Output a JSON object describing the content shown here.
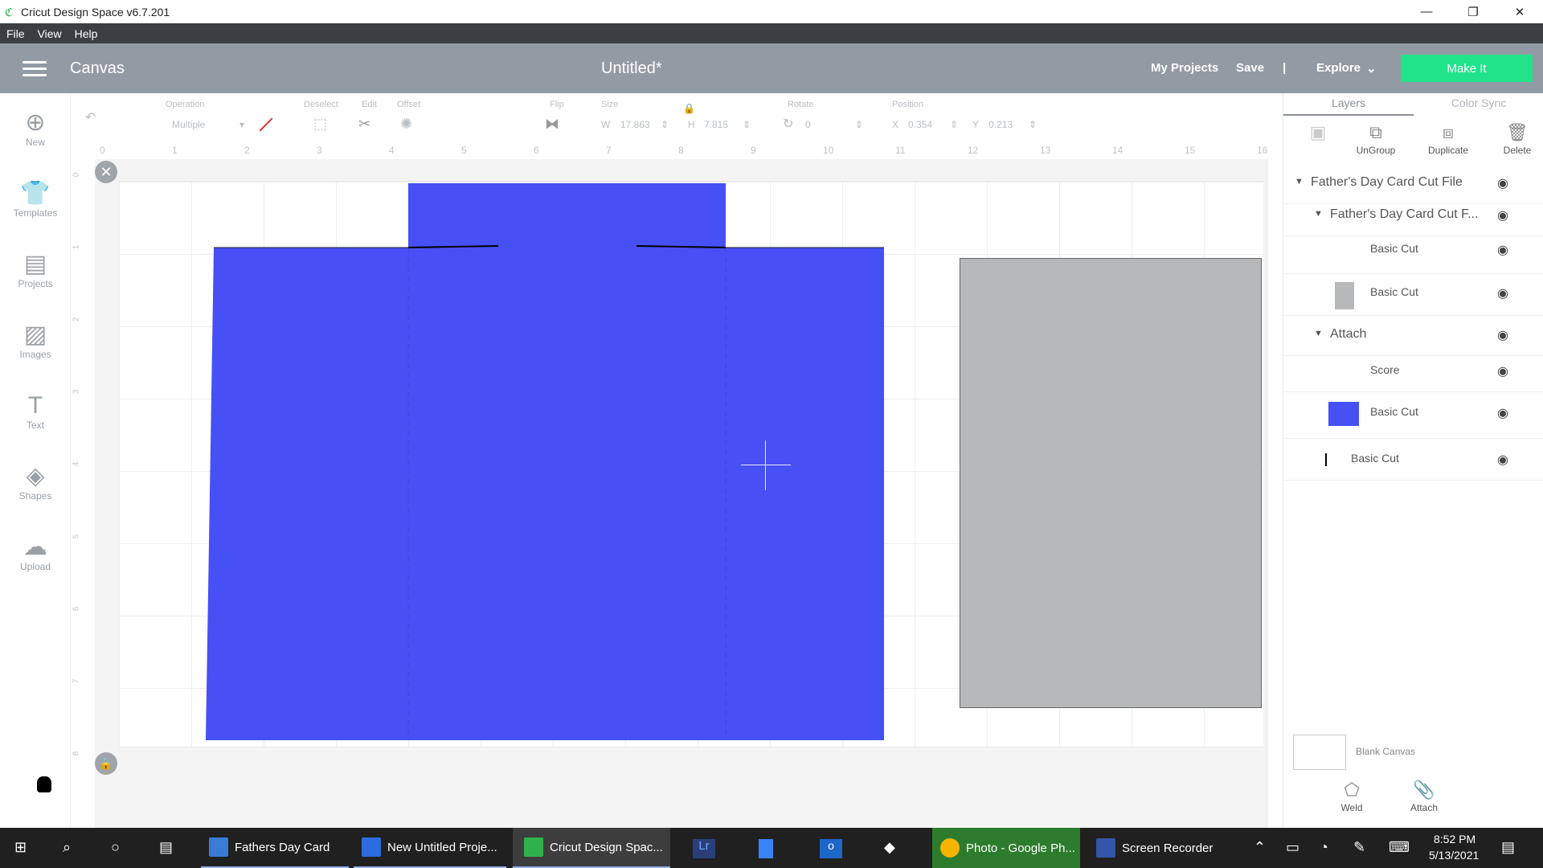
{
  "titlebar": {
    "title": "Cricut Design Space  v6.7.201",
    "minimize": "—",
    "maximize": "❐",
    "close": "✕"
  },
  "menubar": {
    "items": [
      "File",
      "View",
      "Help"
    ]
  },
  "header": {
    "canvas_label": "Canvas",
    "doc_title": "Untitled*",
    "my_projects": "My Projects",
    "save": "Save",
    "separator": "|",
    "explore": "Explore",
    "make_it": "Make It"
  },
  "leftbar": {
    "items": [
      {
        "label": "New",
        "icon": "plus-circle-icon"
      },
      {
        "label": "Templates",
        "icon": "tshirt-icon"
      },
      {
        "label": "Projects",
        "icon": "projects-icon"
      },
      {
        "label": "Images",
        "icon": "image-icon"
      },
      {
        "label": "Text",
        "icon": "text-icon"
      },
      {
        "label": "Shapes",
        "icon": "shapes-icon"
      },
      {
        "label": "Upload",
        "icon": "upload-icon"
      }
    ]
  },
  "edit_toolbar": {
    "operation_label": "Operation",
    "operation_value": "Multiple",
    "deselect_label": "Deselect",
    "edit_label": "Edit",
    "offset_label": "Offset",
    "flip_label": "Flip",
    "size_label": "Size",
    "w_label": "W",
    "w_value": "17.863",
    "h_label": "H",
    "h_value": "7.815",
    "rotate_label": "Rotate",
    "rotate_value": "0",
    "position_label": "Position",
    "x_label": "X",
    "x_value": "0.354",
    "y_label": "Y",
    "y_value": "0.213"
  },
  "ruler": {
    "top": [
      "0",
      "1",
      "2",
      "3",
      "4",
      "5",
      "6",
      "7",
      "8",
      "9",
      "10",
      "11",
      "12",
      "13",
      "14",
      "15",
      "16"
    ],
    "left": [
      "0",
      "1",
      "2",
      "3",
      "4",
      "5",
      "6",
      "7",
      "8"
    ]
  },
  "canvas": {
    "blue_color": "#4650f5",
    "gray_color": "#b7b8ba"
  },
  "right_panel": {
    "tabs": [
      "Layers",
      "Color Sync"
    ],
    "tools": [
      "UnGroup",
      "Duplicate",
      "Delete"
    ],
    "layers": [
      {
        "name": "Father's Day Card Cut File",
        "level": 0,
        "caret": true,
        "swatch": null
      },
      {
        "name": "Father's Day Card Cut F...",
        "level": 1,
        "caret": true,
        "swatch": null
      },
      {
        "name": "Basic Cut",
        "level": 2,
        "caret": false,
        "swatch": "#ffffff"
      },
      {
        "name": "Basic Cut",
        "level": 2,
        "caret": false,
        "swatch": "#b7b8ba"
      },
      {
        "name": "Attach",
        "level": 1,
        "caret": true,
        "swatch": null
      },
      {
        "name": "Score",
        "level": 2,
        "caret": false,
        "swatch": null
      },
      {
        "name": "Basic Cut",
        "level": 2,
        "caret": false,
        "swatch": "#4650f5"
      },
      {
        "name": "Basic Cut",
        "level": 2,
        "caret": false,
        "swatch": "line"
      }
    ],
    "blank_canvas": "Blank Canvas",
    "bottom_tools": [
      "Weld",
      "Attach"
    ]
  },
  "taskbar": {
    "apps": [
      {
        "label": "Fathers Day Card",
        "color": "#3a7bd5"
      },
      {
        "label": "New Untitled Proje...",
        "color": "#2d6cdf"
      },
      {
        "label": "Cricut Design Spac...",
        "color": "#2fb24c"
      },
      {
        "label": "Photo - Google Ph...",
        "color": "#f4b400"
      },
      {
        "label": "Screen Recorder",
        "color": "#3355aa"
      }
    ],
    "time": "8:52 PM",
    "date": "5/13/2021"
  }
}
